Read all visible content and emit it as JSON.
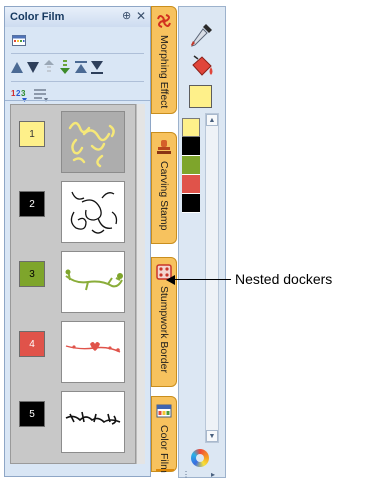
{
  "docker": {
    "title": "Color Film",
    "pin_glyph": "⊕",
    "close_glyph": "✕"
  },
  "film_frames": [
    {
      "number": "1",
      "swatch_color": "#fef08a",
      "label_color": "#333333",
      "selected": true
    },
    {
      "number": "2",
      "swatch_color": "#000000",
      "label_color": "#ffffff",
      "selected": false
    },
    {
      "number": "3",
      "swatch_color": "#7ea52b",
      "label_color": "#000000",
      "selected": false
    },
    {
      "number": "4",
      "swatch_color": "#e0534a",
      "label_color": "#ffffff",
      "selected": false
    },
    {
      "number": "5",
      "swatch_color": "#000000",
      "label_color": "#ffffff",
      "selected": false
    }
  ],
  "side_tabs": [
    {
      "label": "Morphing Effect",
      "icon": "morphing-effect-icon"
    },
    {
      "label": "Carving Stamp",
      "icon": "carving-stamp-icon"
    },
    {
      "label": "Stumpwork Border",
      "icon": "stumpwork-border-icon"
    },
    {
      "label": "Color Film",
      "icon": "color-film-icon"
    }
  ],
  "palette": {
    "current_color": "#fef08a",
    "colors": [
      "#fef08a",
      "#000000",
      "#7ea52b",
      "#e0534a",
      "#000000"
    ]
  },
  "callout": {
    "text": "Nested dockers"
  }
}
